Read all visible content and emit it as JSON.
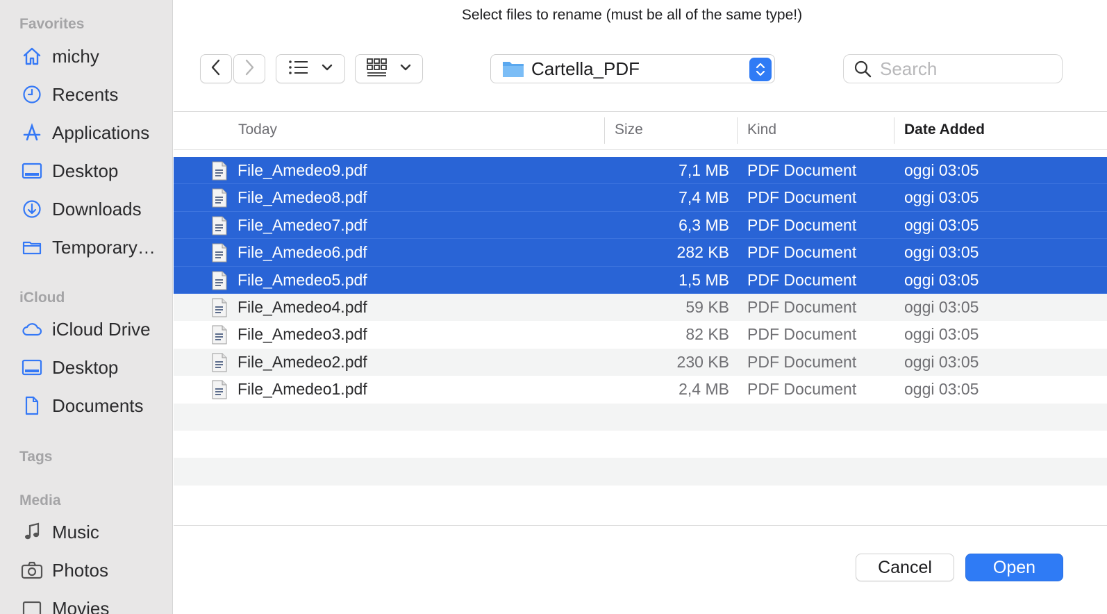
{
  "dialog": {
    "prompt": "Select files to rename (must be all of the same type!)"
  },
  "sidebar": {
    "favorites_label": "Favorites",
    "favorites": [
      {
        "label": "michy",
        "icon": "house-icon"
      },
      {
        "label": "Recents",
        "icon": "clock-icon"
      },
      {
        "label": "Applications",
        "icon": "applications-icon"
      },
      {
        "label": "Desktop",
        "icon": "desktop-icon"
      },
      {
        "label": "Downloads",
        "icon": "download-icon"
      },
      {
        "label": "TemporaryItems",
        "icon": "folder-icon"
      }
    ],
    "icloud_label": "iCloud",
    "icloud": [
      {
        "label": "iCloud Drive",
        "icon": "cloud-icon"
      },
      {
        "label": "Desktop",
        "icon": "desktop-icon"
      },
      {
        "label": "Documents",
        "icon": "document-icon"
      }
    ],
    "tags_label": "Tags",
    "media_label": "Media",
    "media": [
      {
        "label": "Music",
        "icon": "music-note-icon"
      },
      {
        "label": "Photos",
        "icon": "camera-icon"
      },
      {
        "label": "Movies",
        "icon": "film-icon"
      }
    ]
  },
  "toolbar": {
    "location": "Cartella_PDF",
    "search_placeholder": "Search"
  },
  "columns": {
    "name": "Today",
    "size": "Size",
    "kind": "Kind",
    "date": "Date Added"
  },
  "files": [
    {
      "name": "File_Amedeo9.pdf",
      "size": "7,1 MB",
      "kind": "PDF Document",
      "date": "oggi 03:05",
      "selected": true
    },
    {
      "name": "File_Amedeo8.pdf",
      "size": "7,4 MB",
      "kind": "PDF Document",
      "date": "oggi 03:05",
      "selected": true
    },
    {
      "name": "File_Amedeo7.pdf",
      "size": "6,3 MB",
      "kind": "PDF Document",
      "date": "oggi 03:05",
      "selected": true
    },
    {
      "name": "File_Amedeo6.pdf",
      "size": "282 KB",
      "kind": "PDF Document",
      "date": "oggi 03:05",
      "selected": true
    },
    {
      "name": "File_Amedeo5.pdf",
      "size": "1,5 MB",
      "kind": "PDF Document",
      "date": "oggi 03:05",
      "selected": true
    },
    {
      "name": "File_Amedeo4.pdf",
      "size": "59 KB",
      "kind": "PDF Document",
      "date": "oggi 03:05",
      "selected": false
    },
    {
      "name": "File_Amedeo3.pdf",
      "size": "82 KB",
      "kind": "PDF Document",
      "date": "oggi 03:05",
      "selected": false
    },
    {
      "name": "File_Amedeo2.pdf",
      "size": "230 KB",
      "kind": "PDF Document",
      "date": "oggi 03:05",
      "selected": false
    },
    {
      "name": "File_Amedeo1.pdf",
      "size": "2,4 MB",
      "kind": "PDF Document",
      "date": "oggi 03:05",
      "selected": false
    }
  ],
  "buttons": {
    "cancel": "Cancel",
    "open": "Open"
  },
  "colors": {
    "accent": "#2f7bf5",
    "selection": "#2964d6",
    "sidebar_icon": "#3478f6"
  }
}
